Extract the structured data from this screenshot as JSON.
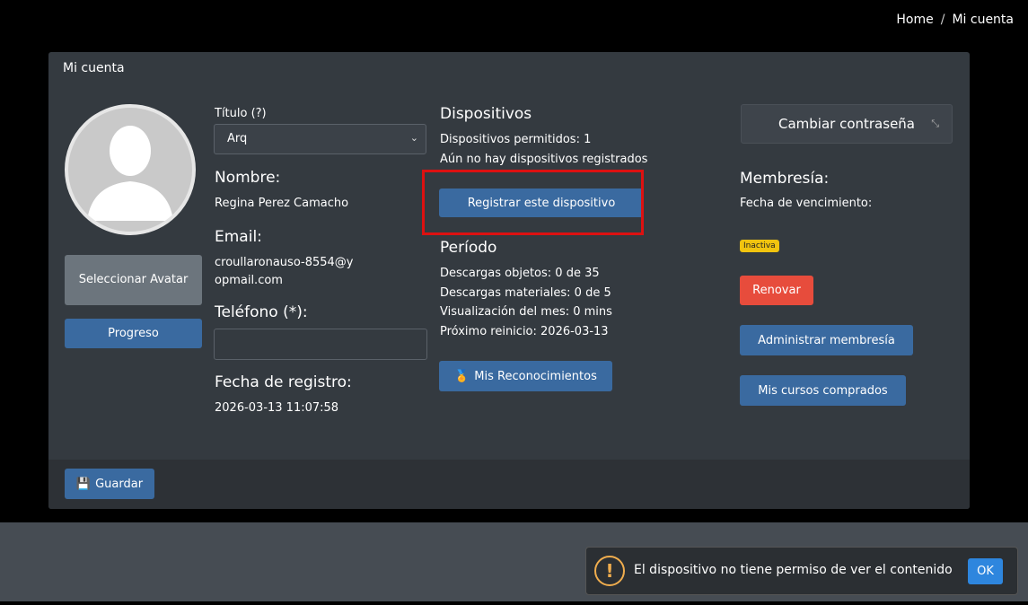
{
  "breadcrumb": {
    "home": "Home",
    "separator": "/",
    "current": "Mi cuenta"
  },
  "card": {
    "title": "Mi cuenta"
  },
  "left": {
    "avatar_icon": "user-silhouette-icon",
    "select_avatar_label": "Seleccionar Avatar",
    "progress_label": "Progreso"
  },
  "profile": {
    "title_label": "Título (?)",
    "title_value": "Arq",
    "name_label": "Nombre:",
    "name_value": "Regina Perez Camacho",
    "email_label": "Email:",
    "email_value": "croullaronauso-8554@yopmail.com",
    "phone_label": "Teléfono (*):",
    "phone_value": "",
    "reg_label": "Fecha de registro:",
    "reg_value": "2026-03-13 11:07:58"
  },
  "devices": {
    "title": "Dispositivos",
    "allowed": "Dispositivos permitidos: 1",
    "none_registered": "Aún no hay dispositivos registrados",
    "register_button": "Registrar este dispositivo"
  },
  "period": {
    "title": "Período",
    "downloads_objects": "Descargas objetos: 0 de 35",
    "downloads_materials": "Descargas materiales: 0 de 5",
    "view_month": "Visualización del mes: 0 mins",
    "next_reset": "Próximo reinicio: 2026-03-13",
    "achievements_button": "Mis Reconocimientos"
  },
  "membership": {
    "change_password": "Cambiar contraseña",
    "title": "Membresía:",
    "expiry_label": "Fecha de vencimiento:",
    "status_badge": "Inactiva",
    "renew_button": "Renovar",
    "manage_button": "Administrar membresía",
    "courses_button": "Mis cursos comprados"
  },
  "footer": {
    "save_button": "Guardar"
  },
  "toast": {
    "message": "El dispositivo no tiene permiso de ver el contenido",
    "ok_button": "OK"
  },
  "colors": {
    "accent": "#3a6aa0",
    "danger": "#e74c3c",
    "warning": "#f1c40f",
    "highlight": "#dd1111"
  }
}
